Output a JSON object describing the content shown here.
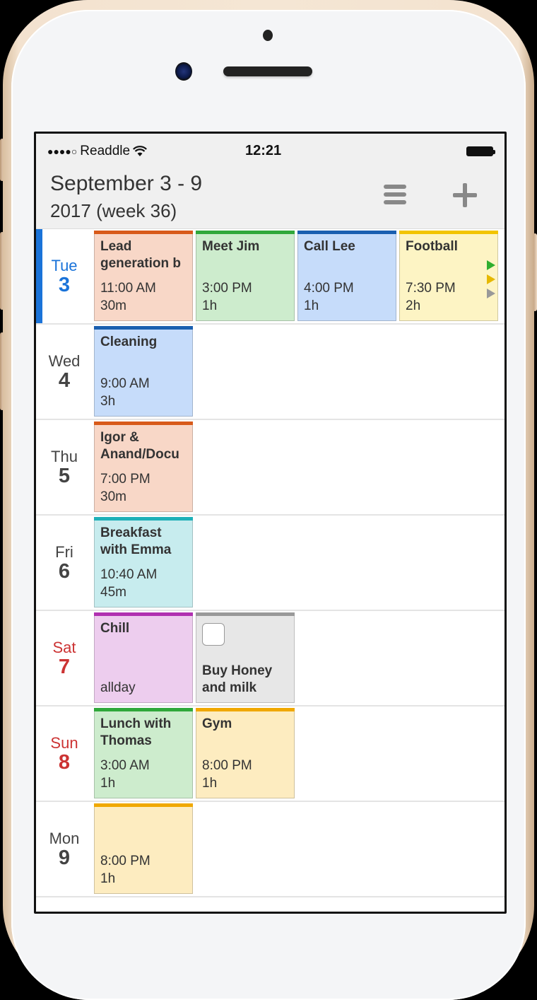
{
  "status_bar": {
    "signal_dots": "●●●●○",
    "carrier": "Readdle",
    "time": "12:21"
  },
  "header": {
    "title": "September 3 - 9",
    "subtitle": "2017 (week 36)",
    "menu_icon": "hamburger-menu-icon",
    "add_icon": "plus-icon"
  },
  "colors": {
    "accent": "#1a73d9",
    "weekend": "#cc3333"
  },
  "days": [
    {
      "name": "Tue",
      "num": "3",
      "today": true,
      "events": [
        {
          "title": "Lead generation b",
          "time": "11:00 AM",
          "duration": "30m",
          "bg": "#f8d7c7",
          "stripe": "#d85a1a"
        },
        {
          "title": "Meet Jim",
          "time": "3:00 PM",
          "duration": "1h",
          "bg": "#cdeccd",
          "stripe": "#2fa83a"
        },
        {
          "title": "Call Lee",
          "time": "4:00 PM",
          "duration": "1h",
          "bg": "#c6dcfa",
          "stripe": "#1a5fb0"
        },
        {
          "title": "Football",
          "time": "7:30 PM",
          "duration": "2h",
          "bg": "#fdf4c4",
          "stripe": "#f2c400"
        }
      ],
      "more_indicators": [
        "#2fae2f",
        "#e6b800",
        "#999999"
      ]
    },
    {
      "name": "Wed",
      "num": "4",
      "events": [
        {
          "title": "Cleaning",
          "time": "9:00 AM",
          "duration": "3h",
          "bg": "#c6dcfa",
          "stripe": "#1a5fb0"
        }
      ]
    },
    {
      "name": "Thu",
      "num": "5",
      "events": [
        {
          "title": "Igor & Anand/Docu",
          "time": "7:00 PM",
          "duration": "30m",
          "bg": "#f8d7c7",
          "stripe": "#d85a1a"
        }
      ]
    },
    {
      "name": "Fri",
      "num": "6",
      "events": [
        {
          "title": "Breakfast with Emma",
          "time": "10:40 AM",
          "duration": "45m",
          "bg": "#c7ecee",
          "stripe": "#1fb0b8"
        }
      ]
    },
    {
      "name": "Sat",
      "num": "7",
      "weekend": true,
      "events": [
        {
          "title": "Chill",
          "time": "allday",
          "duration": "",
          "bg": "#edcdee",
          "stripe": "#b030b0"
        },
        {
          "title": "Buy Honey and milk",
          "task": true,
          "completed": false,
          "bg": "#e7e7e7",
          "stripe": "#999999"
        }
      ]
    },
    {
      "name": "Sun",
      "num": "8",
      "weekend": true,
      "events": [
        {
          "title": "Lunch with Thomas",
          "time": "3:00 AM",
          "duration": "1h",
          "bg": "#cdeccd",
          "stripe": "#2fa83a"
        },
        {
          "title": "Gym",
          "time": "8:00 PM",
          "duration": "1h",
          "bg": "#fdecc0",
          "stripe": "#f0a800"
        }
      ]
    },
    {
      "name": "Mon",
      "num": "9",
      "events": [
        {
          "title": "",
          "time": "8:00 PM",
          "duration": "1h",
          "bg": "#fdecc0",
          "stripe": "#f0a800"
        }
      ]
    }
  ]
}
